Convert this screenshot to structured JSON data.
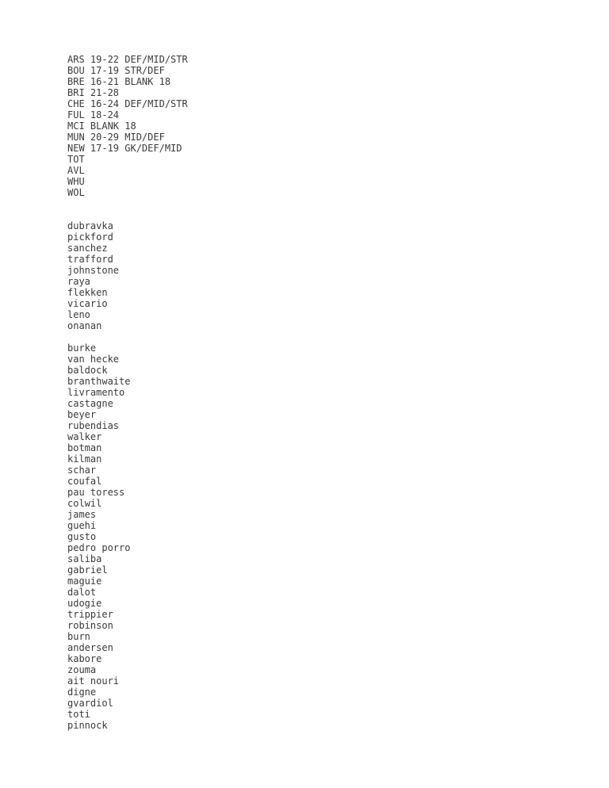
{
  "document": {
    "background_color": "#ffffff",
    "text_color": "#3a3a3a"
  },
  "blocks": [
    {
      "name": "team-fixture-notes",
      "gap_after_lines": 2,
      "lines": [
        "ARS 19-22 DEF/MID/STR",
        "BOU 17-19 STR/DEF",
        "BRE 16-21 BLANK 18",
        "BRI 21-28",
        "CHE 16-24 DEF/MID/STR",
        "FUL 18-24",
        "MCI BLANK 18",
        "MUN 20-29 MID/DEF",
        "NEW 17-19 GK/DEF/MID",
        "TOT",
        "AVL",
        "WHU",
        "WOL"
      ]
    },
    {
      "name": "goalkeeper-list",
      "gap_after_lines": 1,
      "lines": [
        "dubravka",
        "pickford",
        "sanchez",
        "trafford",
        "johnstone",
        "raya",
        "flekken",
        "vicario",
        "leno",
        "onanan"
      ]
    },
    {
      "name": "defender-list",
      "gap_after_lines": 0,
      "lines": [
        "burke",
        "van hecke",
        "baldock",
        "branthwaite",
        "livramento",
        "castagne",
        "beyer",
        "rubendias",
        "walker",
        "botman",
        "kilman",
        "schar",
        "coufal",
        "pau toress",
        "colwil",
        "james",
        "guehi",
        "gusto",
        "pedro porro",
        "saliba",
        "gabriel",
        "maguie",
        "dalot",
        "udogie",
        "trippier",
        "robinson",
        "burn",
        "andersen",
        "kabore",
        "zouma",
        "ait nouri",
        "digne",
        "gvardiol",
        "toti",
        "pinnock"
      ]
    }
  ]
}
